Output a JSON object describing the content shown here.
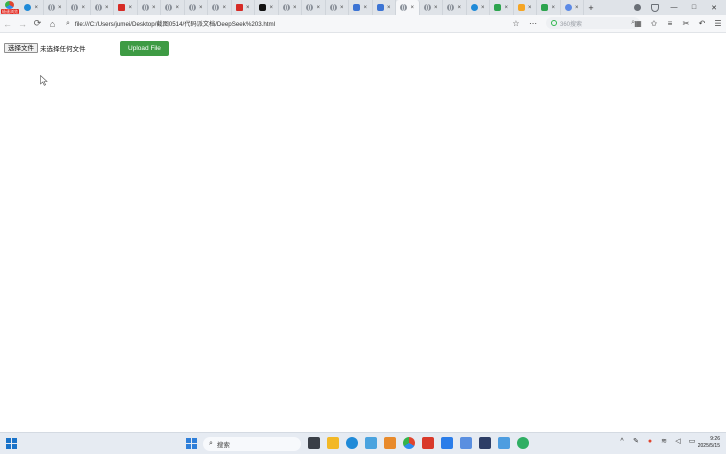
{
  "browser": {
    "logo_badge": "极速浏览",
    "tabs": [
      {
        "icon": "globe-icon",
        "style": "edge"
      },
      {
        "icon": "globe-icon",
        "style": "globe"
      },
      {
        "icon": "globe-icon",
        "style": "globe"
      },
      {
        "icon": "globe-icon",
        "style": "globe"
      },
      {
        "icon": "red-site-icon",
        "style": "red"
      },
      {
        "icon": "globe-icon",
        "style": "globe"
      },
      {
        "icon": "globe-icon",
        "style": "globe"
      },
      {
        "icon": "globe-icon",
        "style": "globe"
      },
      {
        "icon": "globe-icon",
        "style": "globe"
      },
      {
        "icon": "red-site-icon",
        "style": "red"
      },
      {
        "icon": "x-icon",
        "style": "x"
      },
      {
        "icon": "globe-icon",
        "style": "globe"
      },
      {
        "icon": "globe-icon",
        "style": "globe"
      },
      {
        "icon": "globe-icon",
        "style": "globe"
      },
      {
        "icon": "extension-icon",
        "style": "ext"
      },
      {
        "icon": "extension-icon",
        "style": "ext"
      },
      {
        "icon": "globe-icon",
        "style": "globe",
        "active": true
      },
      {
        "icon": "globe-icon",
        "style": "globe"
      },
      {
        "icon": "globe-icon",
        "style": "globe"
      },
      {
        "icon": "edge-icon",
        "style": "edge"
      },
      {
        "icon": "green-site-icon",
        "style": "green"
      },
      {
        "icon": "orange-site-icon",
        "style": "orange"
      },
      {
        "icon": "green-site-icon",
        "style": "green"
      },
      {
        "icon": "site-icon",
        "style": "weird"
      }
    ],
    "tab_close_glyph": "×",
    "new_tab_glyph": "+",
    "address_url": "file:///C:/Users/jumei/Desktop/截图0514/代码派文档/DeepSeek%203.html",
    "search_placeholder": "360搜索",
    "window_controls": {
      "minimize": "—",
      "maximize": "□",
      "close": "✕"
    }
  },
  "page": {
    "file_button_label": "选择文件",
    "file_status": "未选择任何文件",
    "upload_button_label": "Upload File",
    "upload_button_color": "#3e9b44"
  },
  "taskbar": {
    "search_placeholder": "搜索",
    "clock_time": "9:26",
    "clock_date": "2025/5/15"
  }
}
